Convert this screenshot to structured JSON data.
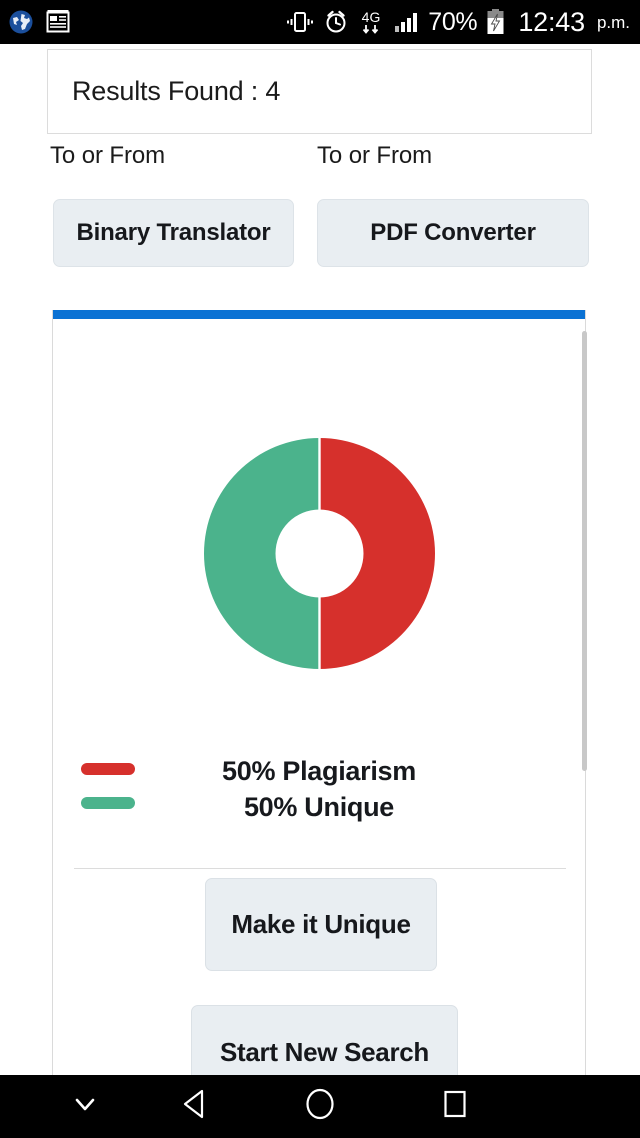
{
  "status_bar": {
    "icons_left": [
      "globe-icon",
      "news-icon"
    ],
    "icons_right": [
      "vibrate-icon",
      "alarm-icon",
      "network-4g-icon",
      "signal-bars-icon",
      "battery-charging-icon"
    ],
    "network_label": "4G",
    "battery_percent": "70%",
    "time": "12:43",
    "am_pm": "p.m."
  },
  "results": {
    "label": "Results Found : 4"
  },
  "tools": {
    "label_left": "To or From",
    "label_right": "To or From",
    "button_left": "Binary Translator",
    "button_right": "PDF Converter"
  },
  "report": {
    "accent_color": "#0b72d4",
    "legend": {
      "plagiarism_label": "50% Plagiarism",
      "unique_label": "50% Unique",
      "plagiarism_color": "#d6302c",
      "unique_color": "#4bb38c"
    },
    "actions": {
      "make_unique": "Make it Unique",
      "start_new_search": "Start New Search"
    }
  },
  "chart_data": {
    "type": "pie",
    "variant": "donut",
    "title": "",
    "categories": [
      "Plagiarism",
      "Unique"
    ],
    "values": [
      50,
      50
    ],
    "units": "%",
    "colors": [
      "#d6302c",
      "#4bb38c"
    ],
    "labels": [
      "50% Plagiarism",
      "50% Unique"
    ],
    "legend_position": "left",
    "start_angle_deg": 0,
    "direction": "clockwise",
    "inner_radius_ratio": 0.62,
    "grid": false
  },
  "nav_bar": {
    "items": [
      "hide-keyboard-icon",
      "back-icon",
      "home-icon",
      "recents-icon"
    ]
  }
}
